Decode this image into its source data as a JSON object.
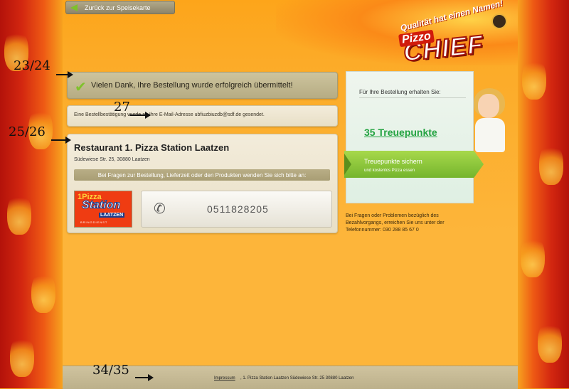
{
  "nav": {
    "back_label": "Zurück zur Speisekarte"
  },
  "logo": {
    "slogan": "Qualität hat einen Namen!",
    "brand_top": "Pizzo",
    "brand_main": "CHIEF"
  },
  "success": {
    "message": "Vielen Dank, Ihre Bestellung wurde erfolgreich übermittelt!"
  },
  "confirmation": {
    "text": "Eine Bestellbestätigung wurde an Ihre E-Mail-Adresse ubfiuzbiuzdb@sdf.de gesendet."
  },
  "restaurant": {
    "name": "Restaurant 1. Pizza Station Laatzen",
    "address": "Südewiese Str. 25, 30880 Laatzen",
    "question_bar": "Bei Fragen zur Bestellung, Lieferzeit oder den Produkten wenden Sie sich bitte an:",
    "logo": {
      "line1": "1Pizza",
      "line2": "Station",
      "line3": "LAATZEN",
      "line4": "BRINGDIENST"
    },
    "phone": "0511828205"
  },
  "loyalty": {
    "heading": "Für Ihre Bestellung erhalten Sie:",
    "points": "35 Treuepunkte",
    "cta_main": "Treuepunkte sichern",
    "cta_sub": "und kostenlos Pizza essen"
  },
  "support": {
    "text": "Bei Fragen oder Problemen bezüglich des Bezahlvorgangs, erreichen Sie uns unter der Telefonnummer: 030 288 85 67 0"
  },
  "footer": {
    "impressum": "Impressum",
    "info": ", 1. Pizza Station Laatzen Südewiese Str. 25 30880 Laatzen"
  },
  "annotations": {
    "a1": "23/24",
    "a2": "27",
    "a3": "25/26",
    "a4": "34/35"
  },
  "colors": {
    "accent_green": "#75b52d",
    "points_green": "#23a341",
    "brand_red": "#d11b0b"
  }
}
